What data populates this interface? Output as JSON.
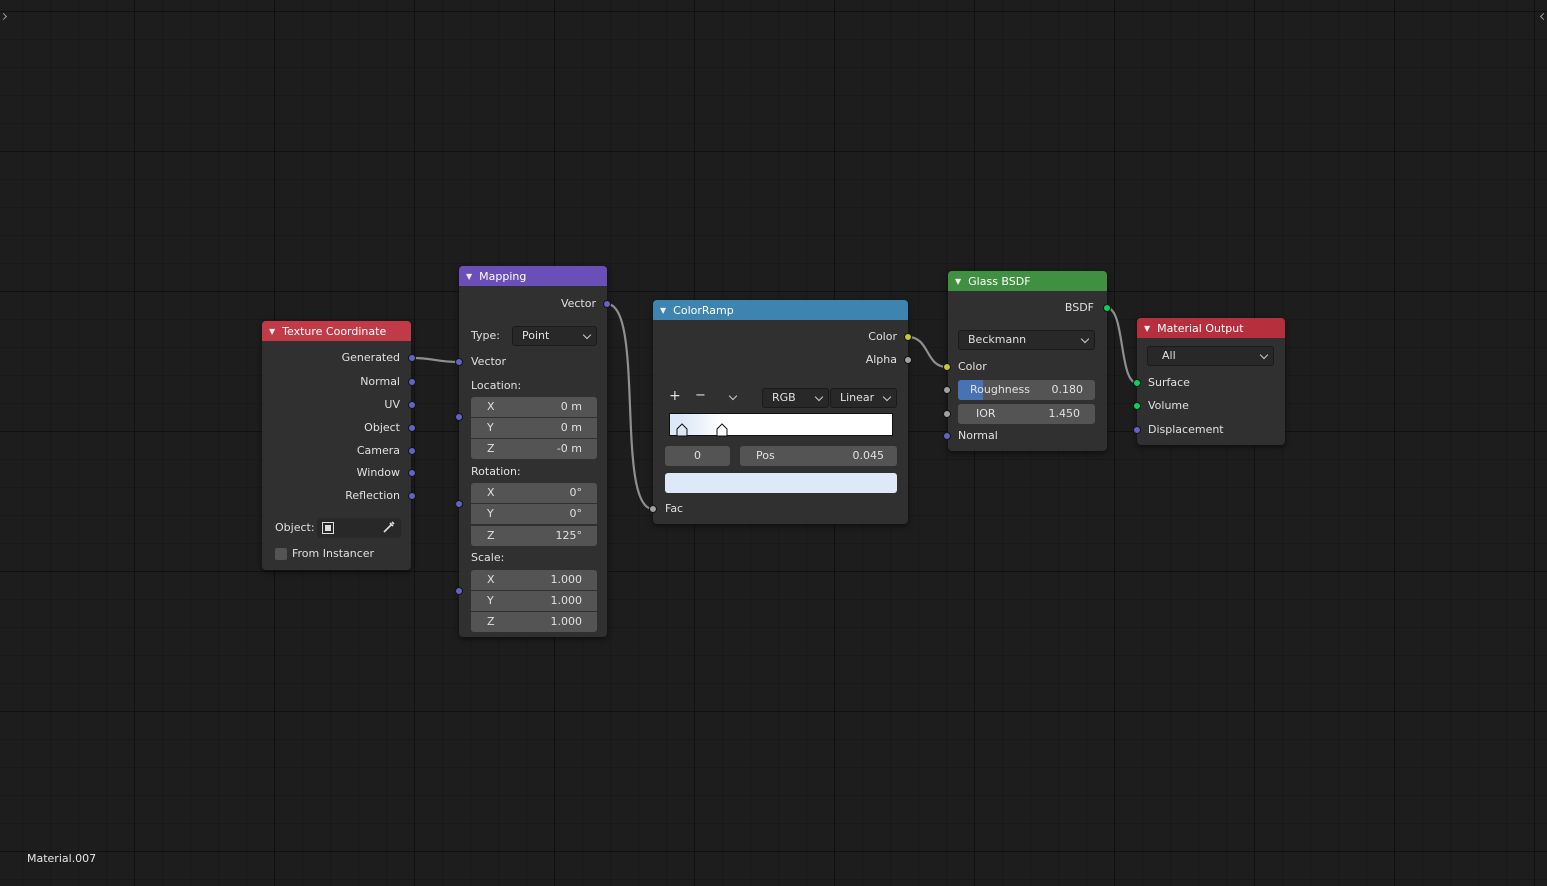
{
  "material_name": "Material.007",
  "texture_coordinate": {
    "title": "Texture Coordinate",
    "outputs": [
      "Generated",
      "Normal",
      "UV",
      "Object",
      "Camera",
      "Window",
      "Reflection"
    ],
    "object_label": "Object:",
    "from_instancer_label": "From Instancer"
  },
  "mapping": {
    "title": "Mapping",
    "output": "Vector",
    "type_label": "Type:",
    "type_value": "Point",
    "vector_label": "Vector",
    "location_label": "Location:",
    "location": {
      "x": "0 m",
      "y": "0 m",
      "z": "-0 m"
    },
    "rotation_label": "Rotation:",
    "rotation": {
      "x": "0°",
      "y": "0°",
      "z": "125°"
    },
    "scale_label": "Scale:",
    "scale": {
      "x": "1.000",
      "y": "1.000",
      "z": "1.000"
    },
    "axis_x": "X",
    "axis_y": "Y",
    "axis_z": "Z"
  },
  "color_ramp": {
    "title": "ColorRamp",
    "output_color": "Color",
    "output_alpha": "Alpha",
    "add_symbol": "+",
    "remove_symbol": "−",
    "color_mode": "RGB",
    "interpolation": "Linear",
    "stop_index": "0",
    "pos_label": "Pos",
    "pos_value": "0.045",
    "stop_color": "#dde8f8",
    "input_fac": "Fac"
  },
  "glass_bsdf": {
    "title": "Glass BSDF",
    "output": "BSDF",
    "distribution": "Beckmann",
    "color_label": "Color",
    "roughness_label": "Roughness",
    "roughness_value": "0.180",
    "roughness_fraction": 0.18,
    "ior_label": "IOR",
    "ior_value": "1.450",
    "normal_label": "Normal"
  },
  "material_output": {
    "title": "Material Output",
    "target": "All",
    "inputs": [
      "Surface",
      "Volume",
      "Displacement"
    ]
  },
  "colors": {
    "input_header": "#c13a48",
    "vector_header": "#6b4fb8",
    "converter_header": "#3d84b0",
    "shader_header": "#3f9040",
    "output_header": "#b52f3c",
    "vector_socket": "#6363c7",
    "color_socket": "#c7c729",
    "float_socket": "#a1a1a1",
    "shader_socket": "#00d65d"
  }
}
